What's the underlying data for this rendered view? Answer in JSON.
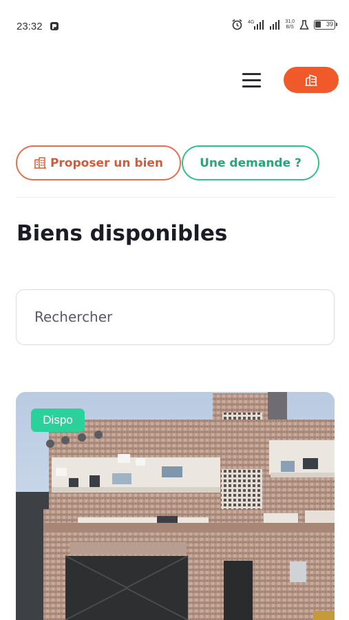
{
  "status_bar": {
    "time": "23:32",
    "speed_value": "31,0",
    "speed_unit": "B/S",
    "battery": "39",
    "icons": [
      "notification-app-icon",
      "alarm-icon",
      "4g-signal-icon",
      "signal-icon",
      "network-speed",
      "vpn-icon",
      "battery-icon"
    ]
  },
  "header": {
    "menu_icon": "hamburger-menu-icon",
    "property_icon": "building-icon",
    "accent_color": "#f0592a"
  },
  "actions": {
    "propose_label": "Proposer un bien",
    "propose_icon": "building-icon",
    "propose_color": "#d75a37",
    "request_label": "Une demande ?",
    "request_color": "#25a77b"
  },
  "main": {
    "title": "Biens disponibles",
    "search": {
      "placeholder": "Rechercher",
      "value": ""
    }
  },
  "listings": [
    {
      "badge": "Dispo",
      "badge_color": "#2bd19a",
      "image": "multi-storey-building-photo"
    }
  ]
}
